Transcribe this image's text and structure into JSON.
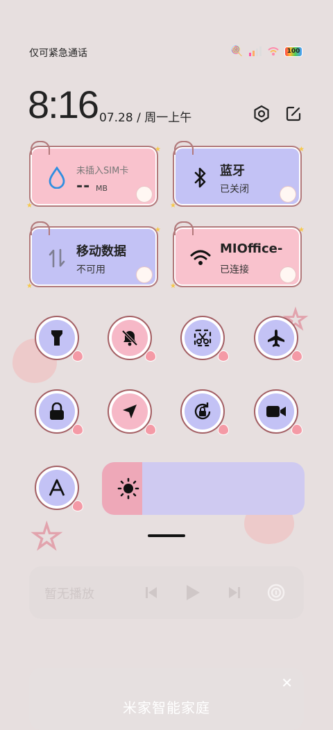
{
  "status": {
    "carrier_text": "仅可紧急通话",
    "battery": "100"
  },
  "header": {
    "time": "8:16",
    "date": "07.28 / 周一上午"
  },
  "tiles": {
    "sim": {
      "line1": "未插入SIM卡",
      "value": "--",
      "unit": "MB"
    },
    "bluetooth": {
      "title": "蓝牙",
      "status": "已关闭"
    },
    "mobile_data": {
      "title": "移动数据",
      "status": "不可用"
    },
    "wifi": {
      "title": "MIOffice-",
      "status": "已连接"
    }
  },
  "toggles": [
    {
      "name": "flashlight",
      "icon": "flashlight-icon",
      "active": true
    },
    {
      "name": "mute",
      "icon": "bell-off-icon",
      "active": false
    },
    {
      "name": "screenshot",
      "icon": "scissors-icon",
      "active": true
    },
    {
      "name": "airplane",
      "icon": "airplane-icon",
      "active": true
    },
    {
      "name": "lock-screen",
      "icon": "lock-icon",
      "active": true
    },
    {
      "name": "location",
      "icon": "location-arrow-icon",
      "active": false
    },
    {
      "name": "rotation-lock",
      "icon": "rotation-lock-icon",
      "active": true
    },
    {
      "name": "screen-record",
      "icon": "video-camera-icon",
      "active": true
    },
    {
      "name": "font-size",
      "icon": "font-a-icon",
      "active": true
    }
  ],
  "brightness": {
    "level": 0.2
  },
  "media": {
    "label": "暂无播放"
  },
  "smart_home": {
    "label": "米家智能家庭",
    "close": "✕"
  },
  "colors": {
    "pink": "#f9c2cd",
    "purple": "#c3c2f5",
    "border": "#b2797b",
    "bg": "#e7dfdf"
  }
}
